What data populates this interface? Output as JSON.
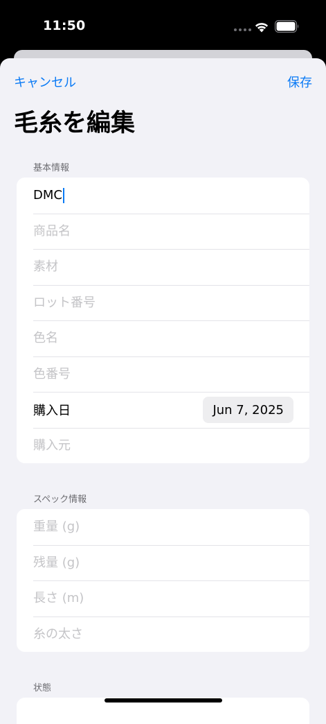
{
  "status_bar": {
    "time": "11:50"
  },
  "nav": {
    "cancel_label": "キャンセル",
    "save_label": "保存"
  },
  "title": "毛糸を編集",
  "basic_info": {
    "header": "基本情報",
    "brand_value": "DMC",
    "product_name_placeholder": "商品名",
    "material_placeholder": "素材",
    "lot_number_placeholder": "ロット番号",
    "color_name_placeholder": "色名",
    "color_number_placeholder": "色番号",
    "purchase_date_label": "購入日",
    "purchase_date_value": "Jun 7, 2025",
    "purchase_store_placeholder": "購入元"
  },
  "spec_info": {
    "header": "スペック情報",
    "weight_placeholder": "重量 (g)",
    "remaining_placeholder": "残量 (g)",
    "length_placeholder": "長さ (m)",
    "thickness_placeholder": "糸の太さ"
  },
  "status_section": {
    "header": "状態"
  },
  "colors": {
    "accent": "#0a7af5",
    "background": "#f2f2f7",
    "card": "#ffffff",
    "placeholder": "#c4c4c7"
  }
}
